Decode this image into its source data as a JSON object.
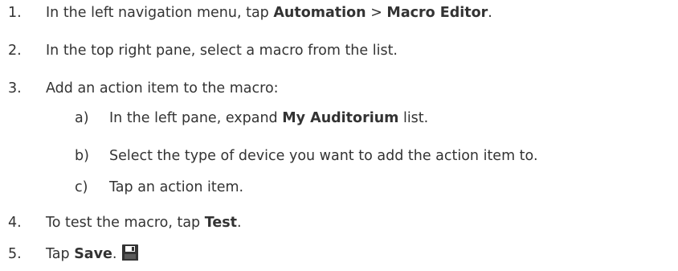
{
  "steps": [
    {
      "number": "1.",
      "parts": [
        "In the left navigation menu, tap ",
        "Automation",
        " > ",
        "Macro Editor",
        "."
      ]
    },
    {
      "number": "2.",
      "text": "In the top right pane, select a macro from the list."
    },
    {
      "number": "3.",
      "text": "Add an action item to the macro:",
      "substeps": [
        {
          "letter": "a)",
          "parts": [
            "In the left pane, expand ",
            "My Auditorium",
            " list."
          ]
        },
        {
          "letter": "b)",
          "text": "Select the type of device you want to add the action item to."
        },
        {
          "letter": "c)",
          "text": "Tap an action item."
        }
      ]
    },
    {
      "number": "4.",
      "parts": [
        "To test the macro, tap ",
        "Test",
        "."
      ]
    },
    {
      "number": "5.",
      "parts": [
        "Tap ",
        "Save",
        "."
      ],
      "icon": "save-icon"
    }
  ]
}
